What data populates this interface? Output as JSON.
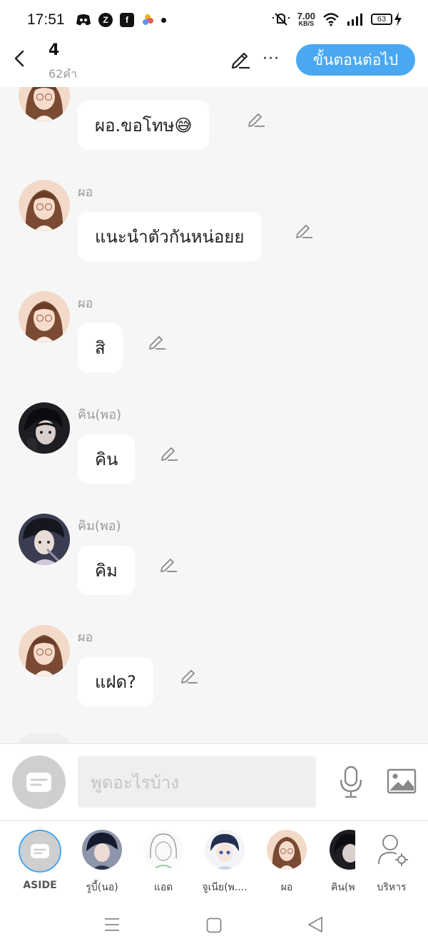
{
  "status_bar": {
    "time": "17:51",
    "speed_value": "7.00",
    "speed_unit": "KB/S",
    "battery": "63",
    "left_icons": [
      "discord-icon",
      "app-z-icon",
      "facebook-icon",
      "photos-icon",
      "notification-dot-icon"
    ],
    "right_icons": [
      "mute-icon",
      "wifi-icon",
      "signal-icon",
      "battery-icon",
      "charging-icon"
    ]
  },
  "header": {
    "title": "4",
    "subtitle": "62คำ",
    "next_button": "ขั้นตอนต่อไป",
    "more": "···"
  },
  "messages": [
    {
      "sender": "",
      "text": "ผอ.ขอโทษ😅",
      "avatar": "girl-glasses-avatar"
    },
    {
      "sender": "ผอ",
      "text": "แนะนำตัวกันหน่อยย",
      "avatar": "girl-glasses-avatar"
    },
    {
      "sender": "ผอ",
      "text": "สิ",
      "avatar": "girl-glasses-avatar"
    },
    {
      "sender": "คิน(พอ)",
      "text": "คิน",
      "avatar": "dark-boy-avatar"
    },
    {
      "sender": "คิม(พอ)",
      "text": "คิม",
      "avatar": "boy-avatar"
    },
    {
      "sender": "ผอ",
      "text": "แฝด?",
      "avatar": "girl-glasses-avatar"
    }
  ],
  "composer": {
    "placeholder": "พูดอะไรบ้าง"
  },
  "characters": [
    {
      "label": "ASIDE",
      "avatar": "aside-icon"
    },
    {
      "label": "รูบี้(นอ)",
      "avatar": "boy-blue-avatar"
    },
    {
      "label": "แอด",
      "avatar": "sketch-avatar"
    },
    {
      "label": "จูเนีย(พ....",
      "avatar": "anime-boy-avatar"
    },
    {
      "label": "ผอ",
      "avatar": "girl-glasses-avatar"
    },
    {
      "label": "คิน(พ",
      "avatar": "dark-boy-avatar"
    },
    {
      "label": "บริหาร",
      "avatar": "manage-user-icon"
    }
  ],
  "colors": {
    "accent": "#4aa8f2",
    "background": "#f6f6f6",
    "bubble": "#ffffff"
  }
}
